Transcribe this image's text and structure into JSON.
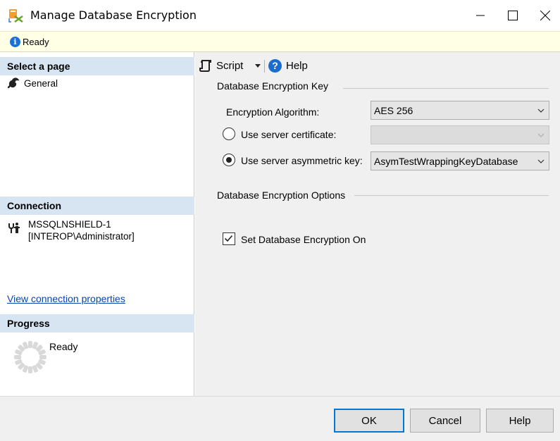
{
  "window": {
    "title": "Manage Database Encryption"
  },
  "status": {
    "text": "Ready"
  },
  "sidebar": {
    "select_page_header": "Select a page",
    "pages": [
      {
        "label": "General"
      }
    ],
    "connection_header": "Connection",
    "connection_server": "MSSQLNSHIELD-1",
    "connection_user": "[INTEROP\\Administrator]",
    "connection_link": "View connection properties",
    "progress_header": "Progress",
    "progress_status": "Ready"
  },
  "toolbar": {
    "script_label": "Script",
    "help_label": "Help"
  },
  "encryption_key": {
    "group_label": "Database Encryption Key",
    "algorithm_label": "Encryption Algorithm:",
    "algorithm_value": "AES 256",
    "server_cert_label": "Use server certificate:",
    "server_cert_value": "",
    "server_cert_selected": false,
    "asym_key_label": "Use server asymmetric key:",
    "asym_key_value": "AsymTestWrappingKeyDatabase",
    "asym_key_selected": true
  },
  "options": {
    "group_label": "Database Encryption Options",
    "encryption_on_label": "Set Database Encryption On",
    "encryption_on_checked": true
  },
  "buttons": {
    "ok": "OK",
    "cancel": "Cancel",
    "help": "Help"
  },
  "colors": {
    "status_bg": "#ffffe6",
    "section_header_bg": "#d7e4f2",
    "link": "#0645ad",
    "accent": "#0078d7"
  }
}
